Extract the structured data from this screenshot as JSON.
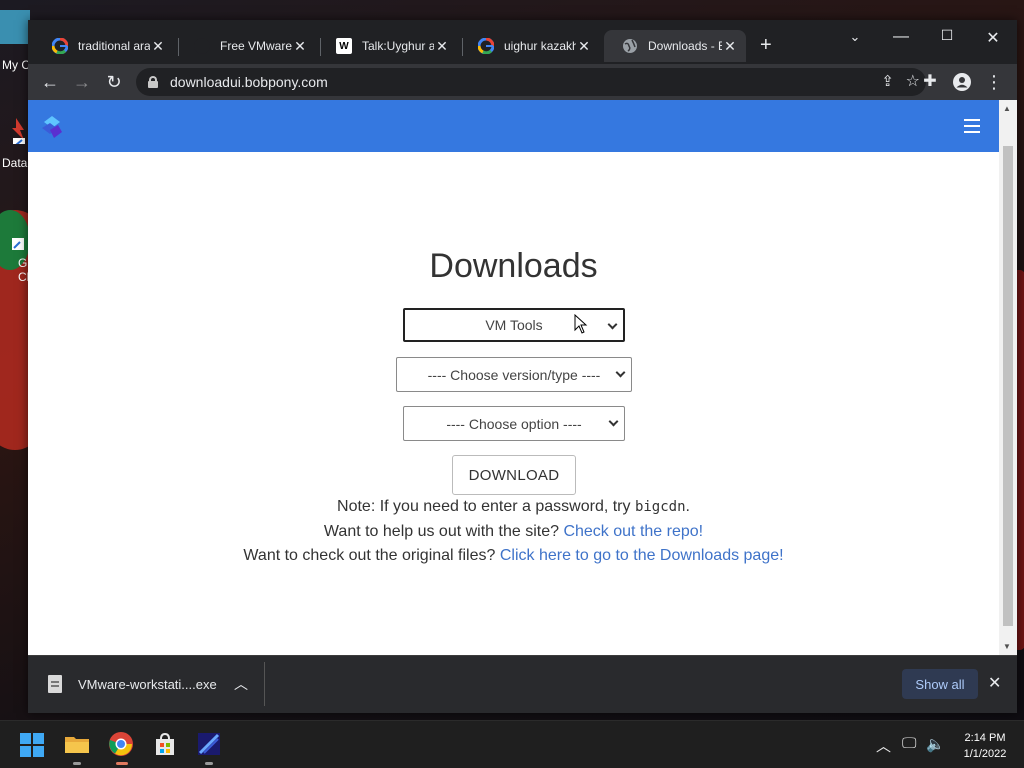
{
  "desktop": {
    "icons": [
      {
        "label": "My C"
      },
      {
        "label": "Data"
      },
      {
        "label": "G\nCl"
      }
    ]
  },
  "browser": {
    "tabs": [
      {
        "title": "traditional arab",
        "favicon": "google-icon"
      },
      {
        "title": "Free VMware W",
        "favicon": "vmware-icon"
      },
      {
        "title": "Talk:Uyghur alp",
        "favicon": "wikipedia-icon"
      },
      {
        "title": "uighur kazakh",
        "favicon": "google-icon"
      },
      {
        "title": "Downloads - B",
        "favicon": "globe-icon",
        "active": true
      }
    ],
    "url": "downloadui.bobpony.com"
  },
  "page": {
    "heading": "Downloads",
    "product_select": "VM Tools",
    "version_select": "---- Choose version/type ----",
    "option_select": "---- Choose option ----",
    "download_button": "DOWNLOAD",
    "note_prefix": "Note: If you need to enter a password, try ",
    "note_password": "bigcdn",
    "note_suffix": ".",
    "help_prefix": "Want to help us out with the site? ",
    "help_link": "Check out the repo!",
    "original_prefix": "Want to check out the original files? ",
    "original_link": "Click here to go to the Downloads page!"
  },
  "download_bar": {
    "filename": "VMware-workstati....exe",
    "show_all": "Show all"
  },
  "taskbar": {
    "time": "2:14 PM",
    "date": "1/1/2022"
  },
  "colors": {
    "navbar": "#3578e0",
    "link": "#3f73c9"
  }
}
